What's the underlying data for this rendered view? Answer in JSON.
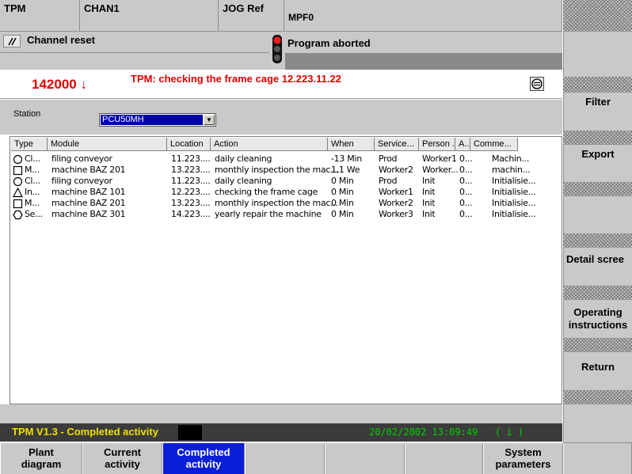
{
  "header": {
    "app": "TPM",
    "channel": "CHAN1",
    "mode": "JOG Ref",
    "program": "MPF0",
    "channel_status": "Channel reset",
    "program_status": "Program aborted",
    "reset_icon": "channel-reset-icon",
    "signal_icon": "traffic-light-icon"
  },
  "info": {
    "value": "142000",
    "arrow": "↓",
    "message": "TPM: checking the frame cage 12.223.11.22",
    "message_color": "#e00000",
    "icon": "scroll-icon"
  },
  "station": {
    "label": "Station",
    "selected": "PCU50MH",
    "dropdown_icon": "▼"
  },
  "table": {
    "columns": [
      "Type",
      "Module",
      "Location",
      "Action",
      "When",
      "Service...",
      "Person ...",
      "A...",
      "Comme..."
    ],
    "rows": [
      {
        "icon": "circle-icon",
        "type": "Cl...",
        "module": "filing conveyor",
        "location": "11.223....",
        "action": "daily cleaning",
        "when": "-13 Min",
        "service": "Prod",
        "person": "Worker1",
        "a": "0...",
        "comment": "Machin..."
      },
      {
        "icon": "square-icon",
        "type": "M...",
        "module": "machine BAZ 201",
        "location": "13.223....",
        "action": "monthly inspection the mac...",
        "when": "1,1 We",
        "service": "Worker2",
        "person": "Worker...",
        "a": "0...",
        "comment": "machin..."
      },
      {
        "icon": "circle-icon",
        "type": "Cl...",
        "module": "filing conveyor",
        "location": "11.223....",
        "action": "daily cleaning",
        "when": "0 Min",
        "service": "Prod",
        "person": "Init",
        "a": "0...",
        "comment": "Initialisie..."
      },
      {
        "icon": "triangle-icon",
        "type": "In...",
        "module": "machine BAZ 101",
        "location": "12.223....",
        "action": "checking the frame cage",
        "when": "0 Min",
        "service": "Worker1",
        "person": "Init",
        "a": "0...",
        "comment": "Initialisie..."
      },
      {
        "icon": "square-icon",
        "type": "M...",
        "module": "machine BAZ 201",
        "location": "13.223....",
        "action": "monthly inspection the mac...",
        "when": "0 Min",
        "service": "Worker2",
        "person": "Init",
        "a": "0...",
        "comment": "Initialisie..."
      },
      {
        "icon": "hexagon-icon",
        "type": "Se...",
        "module": "machine BAZ 301",
        "location": "14.223....",
        "action": "yearly repair the machine",
        "when": "0 Min",
        "service": "Worker3",
        "person": "Init",
        "a": "0...",
        "comment": "Initialisie..."
      }
    ]
  },
  "status": {
    "title": "TPM V1.3 - Completed activity",
    "datetime": "20/02/2002  13:09:49",
    "indicator": "( i )",
    "title_color": "#f0e000",
    "datetime_color": "#00d000"
  },
  "softkeys_vertical": [
    "",
    "",
    "Filter",
    "Export",
    "",
    "Detail scree",
    "Operating instructions",
    "Return",
    ""
  ],
  "softkeys_horizontal": [
    "Plant diagram",
    "Current activity",
    "Completed activity",
    "",
    "",
    "",
    "System parameters",
    ""
  ],
  "active_softkey_color": "#0a1ed8"
}
